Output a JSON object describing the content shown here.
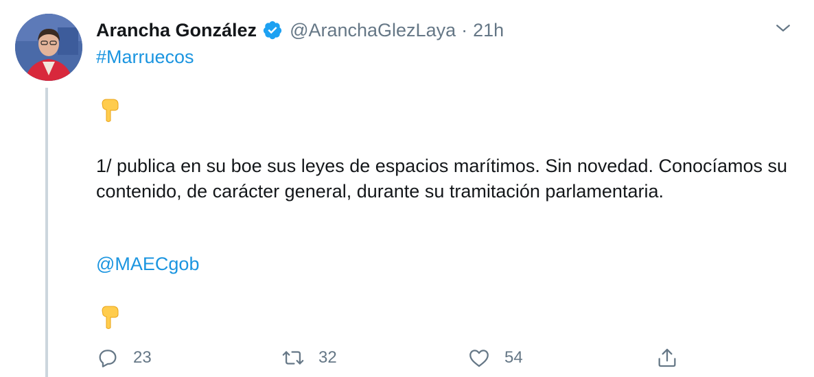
{
  "author": {
    "name": "Arancha González",
    "handle": "@AranchaGlezLaya",
    "separator": "·",
    "time": "21h",
    "verified": true
  },
  "tweet": {
    "hashtag": "#Marruecos",
    "body": "1/ publica en su boe sus leyes de espacios marítimos. Sin novedad. Conocíamos su contenido, de carácter general, durante su tramitación parlamentaria.",
    "mention": "@MAECgob"
  },
  "actions": {
    "replies": "23",
    "retweets": "32",
    "likes": "54"
  },
  "colors": {
    "link": "#1b95e0",
    "secondary_text": "#657786",
    "thread_line": "#ccd6dd",
    "verified_badge": "#1da1f2"
  },
  "icons": [
    "verified-icon",
    "chevron-down-icon",
    "pointing-down-emoji",
    "reply-icon",
    "retweet-icon",
    "like-icon",
    "share-icon"
  ]
}
